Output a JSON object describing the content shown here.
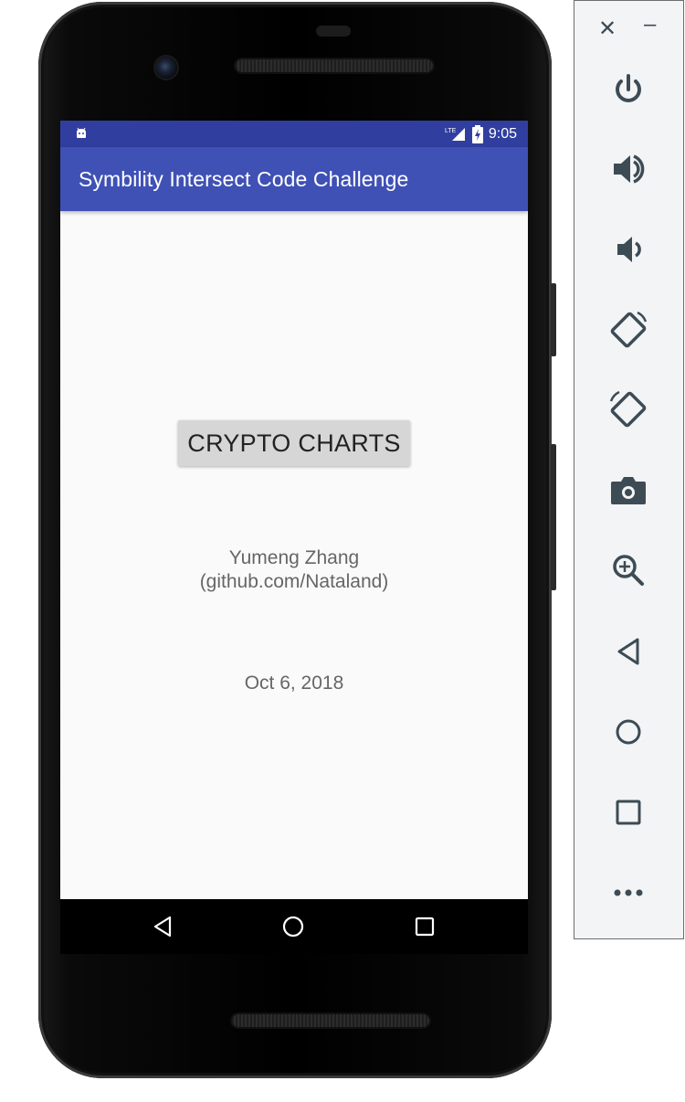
{
  "status_bar": {
    "time": "9:05",
    "network_label": "LTE",
    "icons": [
      "android-robot-icon",
      "lte-signal-icon",
      "battery-charging-icon"
    ]
  },
  "app_bar": {
    "title": "Symbility Intersect Code Challenge"
  },
  "main": {
    "button_label": "CRYPTO CHARTS",
    "author_name": "Yumeng Zhang",
    "author_link": "(github.com/Nataland)",
    "date": "Oct 6, 2018"
  },
  "nav_bar": {
    "icons": [
      "back-icon",
      "home-icon",
      "recents-icon"
    ]
  },
  "emulator_panel": {
    "window_controls": [
      "close-icon",
      "minimize-icon"
    ],
    "buttons": [
      "power-icon",
      "volume-up-icon",
      "volume-down-icon",
      "rotate-left-icon",
      "rotate-right-icon",
      "camera-icon",
      "zoom-icon",
      "back-icon",
      "home-icon",
      "overview-icon",
      "more-icon"
    ]
  },
  "colors": {
    "status_bar": "#303f9f",
    "app_bar": "#3f51b5",
    "background": "#fafafa",
    "button": "#d6d6d6",
    "panel_icon": "#3d4b54"
  }
}
